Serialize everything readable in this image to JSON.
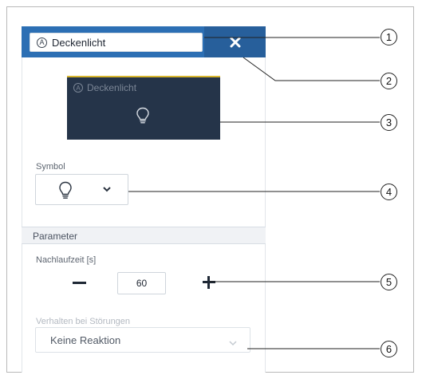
{
  "header": {
    "name_value": "Deckenlicht",
    "name_icon": "a-circle-icon",
    "close_label": "×"
  },
  "tile": {
    "label": "Deckenlicht",
    "icon": "lightbulb-icon"
  },
  "symbol": {
    "label": "Symbol",
    "selected_icon": "lightbulb-icon"
  },
  "parameter": {
    "section_title": "Parameter",
    "nachlauf_label": "Nachlaufzeit [s]",
    "nachlauf_value": "60"
  },
  "behaviour": {
    "label": "Verhalten bei Störungen",
    "selected": "Keine Reaktion"
  },
  "callouts": [
    "1",
    "2",
    "3",
    "4",
    "5",
    "6"
  ],
  "colors": {
    "header_blue": "#2c6fb4",
    "tile_bg": "#253449",
    "tile_accent": "#d7b52c"
  }
}
